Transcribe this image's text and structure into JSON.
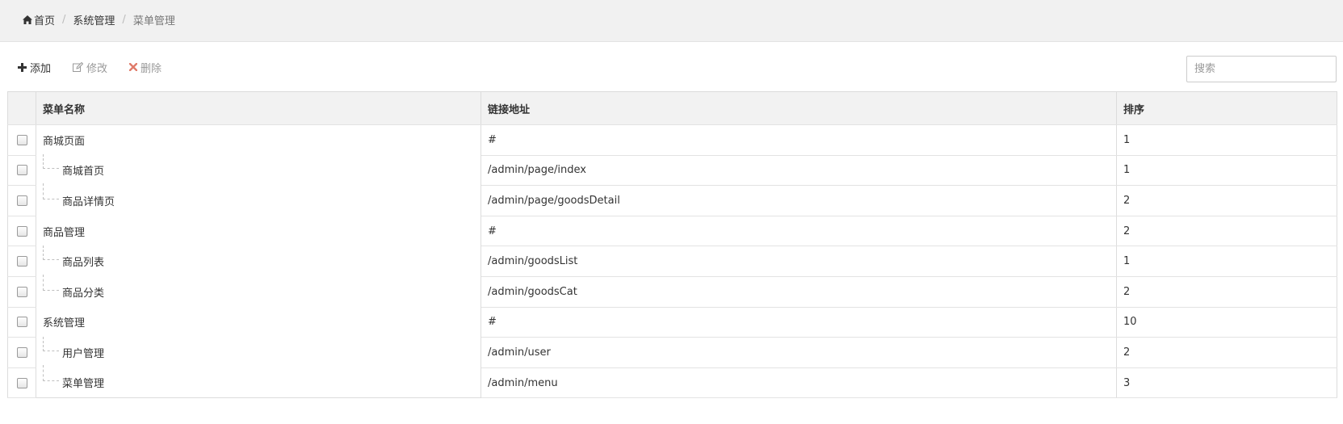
{
  "breadcrumb": {
    "home": "首页",
    "section": "系统管理",
    "current": "菜单管理"
  },
  "toolbar": {
    "add_label": "添加",
    "edit_label": "修改",
    "delete_label": "删除"
  },
  "search": {
    "placeholder": "搜索",
    "value": ""
  },
  "table": {
    "columns": [
      "菜单名称",
      "链接地址",
      "排序"
    ],
    "rows": [
      {
        "name": "商城页面",
        "url": "#",
        "order": "1",
        "level": "parent"
      },
      {
        "name": "商城首页",
        "url": "/admin/page/index",
        "order": "1",
        "level": "child"
      },
      {
        "name": "商品详情页",
        "url": "/admin/page/goodsDetail",
        "order": "2",
        "level": "child-last"
      },
      {
        "name": "商品管理",
        "url": "#",
        "order": "2",
        "level": "parent"
      },
      {
        "name": "商品列表",
        "url": "/admin/goodsList",
        "order": "1",
        "level": "child"
      },
      {
        "name": "商品分类",
        "url": "/admin/goodsCat",
        "order": "2",
        "level": "child-last"
      },
      {
        "name": "系统管理",
        "url": "#",
        "order": "10",
        "level": "parent"
      },
      {
        "name": "用户管理",
        "url": "/admin/user",
        "order": "2",
        "level": "child"
      },
      {
        "name": "菜单管理",
        "url": "/admin/menu",
        "order": "3",
        "level": "child-last"
      }
    ]
  },
  "colors": {
    "delete_icon": "#e07b6a",
    "header_bg": "#f2f2f2",
    "breadcrumb_bg": "#f1f1f1"
  },
  "icons": [
    "home-icon",
    "plus-icon",
    "edit-icon",
    "close-icon"
  ]
}
